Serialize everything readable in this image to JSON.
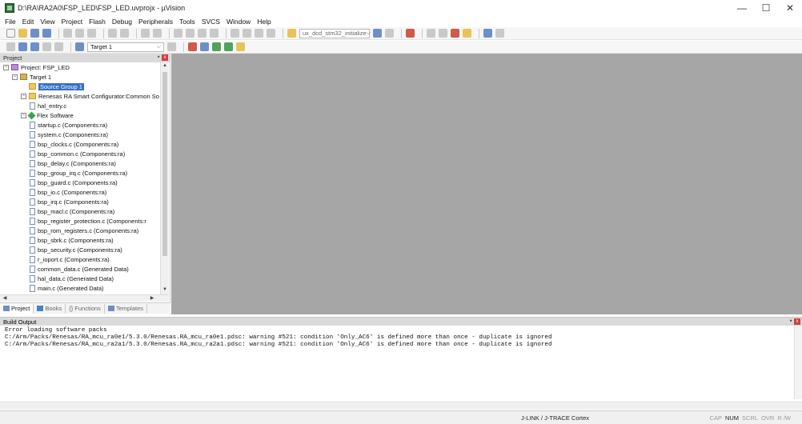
{
  "window": {
    "title": "D:\\RA\\RA2A0\\FSP_LED\\FSP_LED.uvprojx - µVision",
    "minimize": "—",
    "maximize": "☐",
    "close": "✕"
  },
  "menu": [
    "File",
    "Edit",
    "View",
    "Project",
    "Flash",
    "Debug",
    "Peripherals",
    "Tools",
    "SVCS",
    "Window",
    "Help"
  ],
  "toolbar": {
    "find_combo": "ux_dcd_stm32_initialize",
    "target_combo": "Target 1",
    "combo_arrow": "⌵"
  },
  "project_panel": {
    "title": "Project",
    "pin": "⭑",
    "close": "x",
    "tree": [
      {
        "label": "Project: FSP_LED",
        "level": 0,
        "icon": "project-icon",
        "toggle": "−"
      },
      {
        "label": "Target 1",
        "level": 1,
        "icon": "target-icon",
        "toggle": "−"
      },
      {
        "label": "Source Group 1",
        "level": 2,
        "icon": "folder-icon",
        "selected": true
      },
      {
        "label": "Renesas RA Smart Configurator:Common So",
        "level": 2,
        "icon": "folder-icon",
        "toggle": "−"
      },
      {
        "label": "hal_entry.c",
        "level": 3,
        "icon": "file-icon"
      },
      {
        "label": "Flex Software",
        "level": 2,
        "icon": "flex-icon",
        "toggle": "−"
      },
      {
        "label": "startup.c (Components:ra)",
        "level": 3,
        "icon": "file-icon"
      },
      {
        "label": "system.c (Components:ra)",
        "level": 3,
        "icon": "file-icon"
      },
      {
        "label": "bsp_clocks.c (Components:ra)",
        "level": 3,
        "icon": "file-icon"
      },
      {
        "label": "bsp_common.c (Components:ra)",
        "level": 3,
        "icon": "file-icon"
      },
      {
        "label": "bsp_delay.c (Components:ra)",
        "level": 3,
        "icon": "file-icon"
      },
      {
        "label": "bsp_group_irq.c (Components:ra)",
        "level": 3,
        "icon": "file-icon"
      },
      {
        "label": "bsp_guard.c (Components:ra)",
        "level": 3,
        "icon": "file-icon"
      },
      {
        "label": "bsp_io.c (Components:ra)",
        "level": 3,
        "icon": "file-icon"
      },
      {
        "label": "bsp_irq.c (Components:ra)",
        "level": 3,
        "icon": "file-icon"
      },
      {
        "label": "bsp_macl.c (Components:ra)",
        "level": 3,
        "icon": "file-icon"
      },
      {
        "label": "bsp_register_protection.c (Components:r",
        "level": 3,
        "icon": "file-icon"
      },
      {
        "label": "bsp_rom_registers.c (Components:ra)",
        "level": 3,
        "icon": "file-icon"
      },
      {
        "label": "bsp_sbrk.c (Components:ra)",
        "level": 3,
        "icon": "file-icon"
      },
      {
        "label": "bsp_security.c (Components:ra)",
        "level": 3,
        "icon": "file-icon"
      },
      {
        "label": "r_ioport.c (Components:ra)",
        "level": 3,
        "icon": "file-icon"
      },
      {
        "label": "common_data.c (Generated Data)",
        "level": 3,
        "icon": "file-icon"
      },
      {
        "label": "hal_data.c (Generated Data)",
        "level": 3,
        "icon": "file-icon"
      },
      {
        "label": "main.c (Generated Data)",
        "level": 3,
        "icon": "file-icon"
      }
    ],
    "tabs": [
      {
        "label": "Project",
        "active": true
      },
      {
        "label": "Books",
        "active": false
      },
      {
        "label": "{} Functions",
        "active": false
      },
      {
        "label": "Templates",
        "active": false
      }
    ]
  },
  "build_output": {
    "title": "Build Output",
    "lines": [
      "Error loading software packs",
      "C:/Arm/Packs/Renesas/RA_mcu_ra0e1/5.3.0/Renesas.RA_mcu_ra0e1.pdsc: warning #521: condition 'Only_AC6' is defined more than once - duplicate is ignored",
      "C:/Arm/Packs/Renesas/RA_mcu_ra2a1/5.3.0/Renesas.RA_mcu_ra2a1.pdsc: warning #521: condition 'Only_AC6' is defined more than once - duplicate is ignored"
    ]
  },
  "status_bar": {
    "debugger": "J-LINK / J-TRACE Cortex",
    "keys": [
      {
        "label": "CAP",
        "on": false
      },
      {
        "label": "NUM",
        "on": true
      },
      {
        "label": "SCRL",
        "on": false
      },
      {
        "label": "OVR",
        "on": false
      },
      {
        "label": "R /W",
        "on": false
      }
    ]
  }
}
